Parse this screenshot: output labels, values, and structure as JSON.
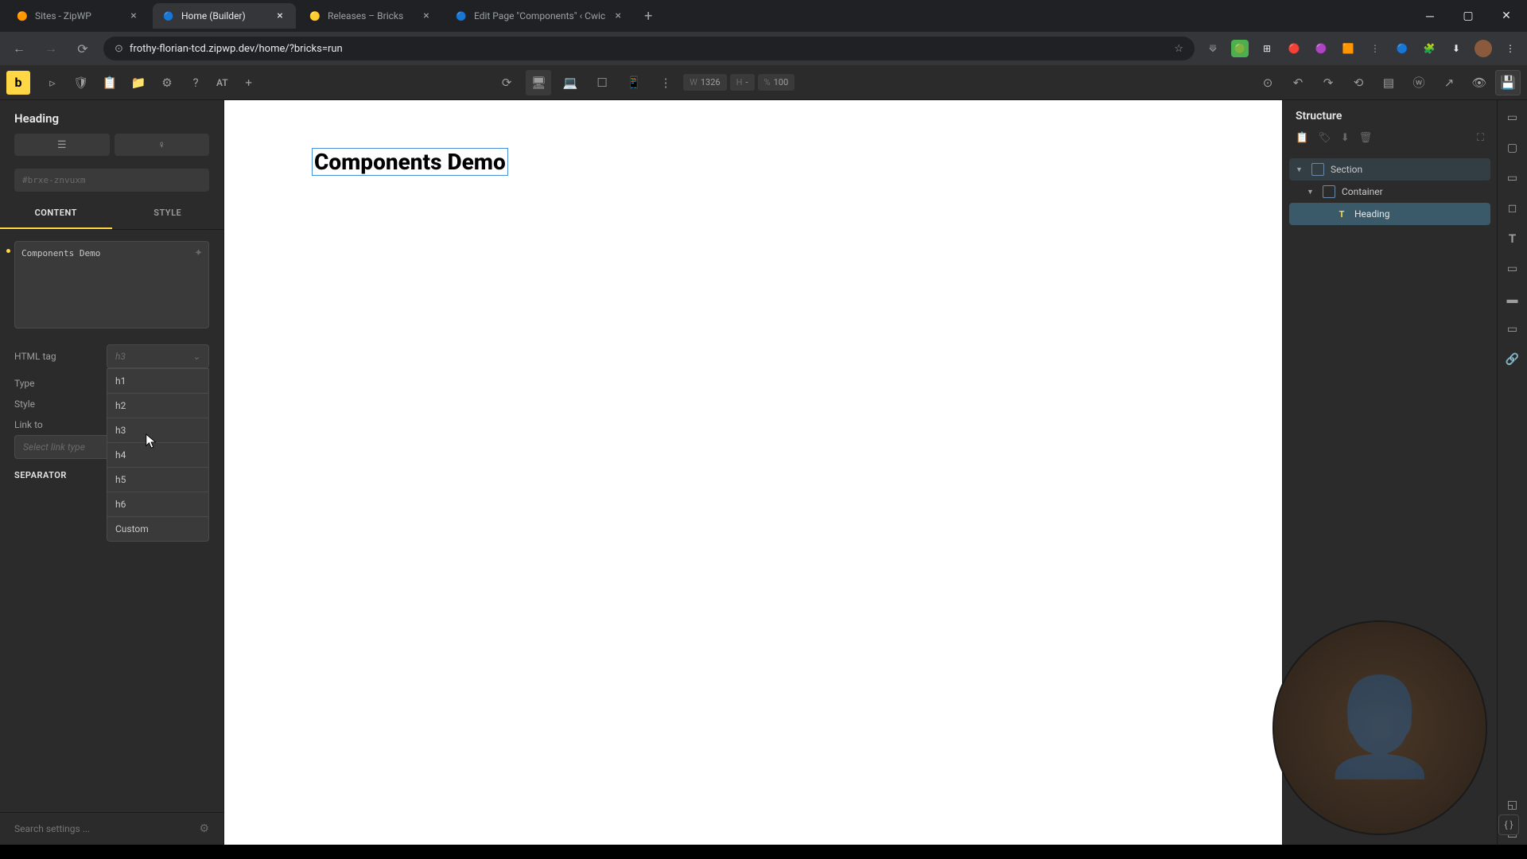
{
  "tabs": [
    {
      "favicon": "🟠",
      "title": "Sites - ZipWP"
    },
    {
      "favicon": "🔵",
      "title": "Home (Builder)",
      "active": true
    },
    {
      "favicon": "🟡",
      "title": "Releases – Bricks"
    },
    {
      "favicon": "🔵",
      "title": "Edit Page \"Components\" ‹ Cwic"
    }
  ],
  "url": "frothy-florian-tcd.zipwp.dev/home/?bricks=run",
  "toolbar": {
    "at": "AT",
    "width_label": "W",
    "width_value": "1326",
    "height_label": "H",
    "height_value": "-",
    "scale_label": "%",
    "scale_value": "100"
  },
  "left_panel": {
    "title": "Heading",
    "element_id": "#brxe-znvuxm",
    "tab_content": "CONTENT",
    "tab_style": "STYLE",
    "textarea_value": "Components Demo",
    "html_tag_label": "HTML tag",
    "html_tag_value": "h3",
    "html_tag_options": [
      "h1",
      "h2",
      "h3",
      "h4",
      "h5",
      "h6",
      "Custom"
    ],
    "type_label": "Type",
    "style_label": "Style",
    "link_to_label": "Link to",
    "link_placeholder": "Select link type",
    "separator_label": "SEPARATOR",
    "search_placeholder": "Search settings ..."
  },
  "canvas": {
    "heading_text": "Components Demo"
  },
  "structure": {
    "title": "Structure",
    "items": [
      {
        "label": "Section",
        "level": 0,
        "type": "section"
      },
      {
        "label": "Container",
        "level": 1,
        "type": "container"
      },
      {
        "label": "Heading",
        "level": 2,
        "type": "heading",
        "active": true
      }
    ]
  }
}
